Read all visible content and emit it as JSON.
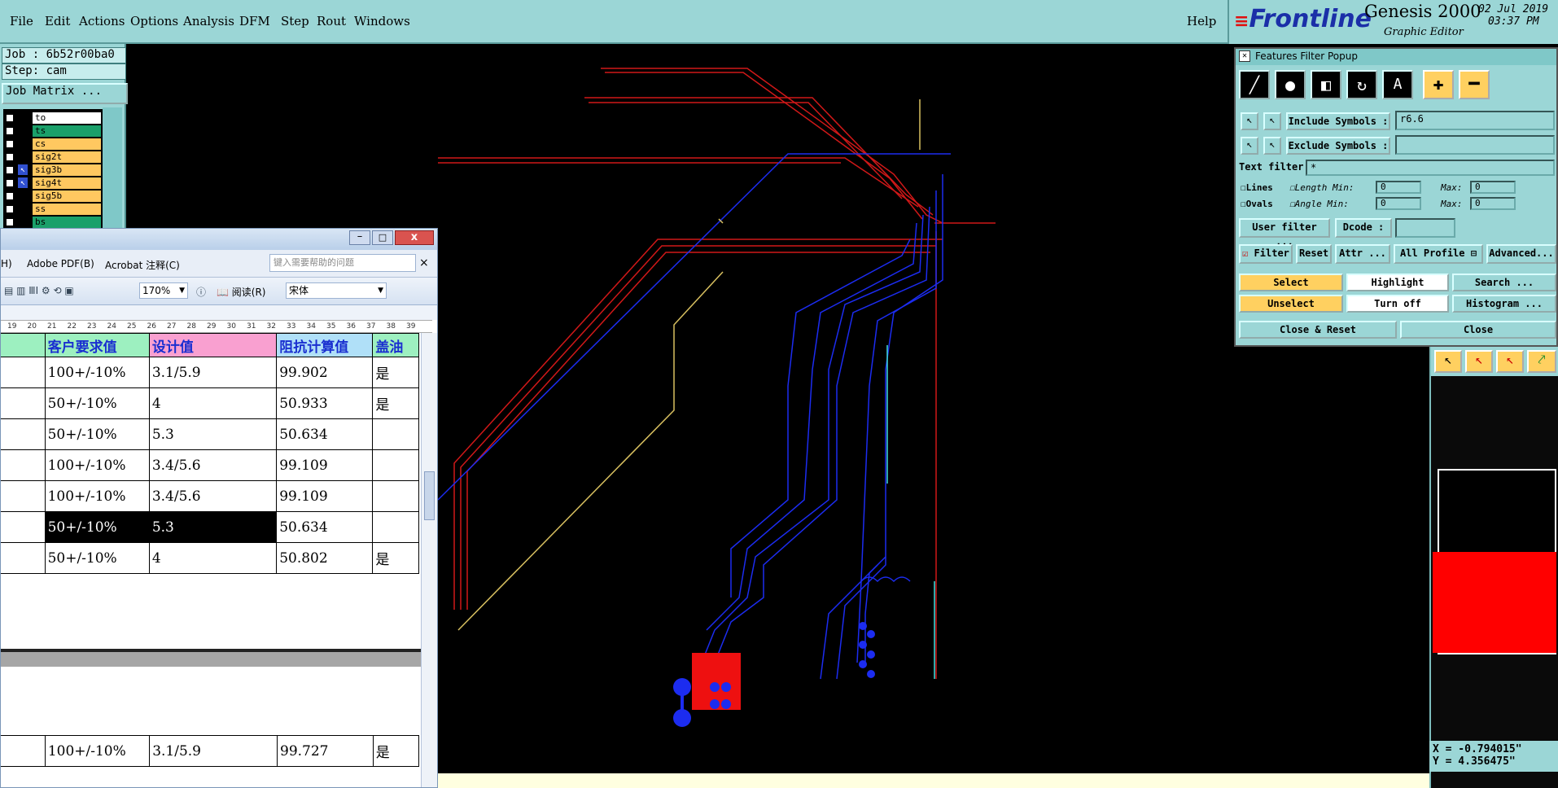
{
  "menubar": {
    "items": [
      "File",
      "Edit",
      "Actions",
      "Options",
      "Analysis",
      "DFM",
      "Step",
      "Rout",
      "Windows"
    ],
    "help": "Help"
  },
  "brand": {
    "logo": "Frontline",
    "product": "Genesis 2000",
    "subtitle": "Graphic Editor",
    "date": "02 Jul 2019",
    "time": "03:37 PM"
  },
  "left": {
    "job": "Job : 6b52r00ba0",
    "step": "Step: cam",
    "matrix_button": "Job Matrix ...",
    "layers": [
      {
        "name": "to",
        "color": "#ffffff",
        "icon": ""
      },
      {
        "name": "ts",
        "color": "#1aa06a",
        "icon": ""
      },
      {
        "name": "cs",
        "color": "#ffc860",
        "icon": ""
      },
      {
        "name": "sig2t",
        "color": "#ffc860",
        "icon": ""
      },
      {
        "name": "sig3b",
        "color": "#ffc860",
        "icon": "arrow"
      },
      {
        "name": "sig4t",
        "color": "#ffc860",
        "icon": "arrow"
      },
      {
        "name": "sig5b",
        "color": "#ffc860",
        "icon": ""
      },
      {
        "name": "ss",
        "color": "#ffc860",
        "icon": ""
      },
      {
        "name": "bs",
        "color": "#1aa06a",
        "icon": ""
      }
    ]
  },
  "word": {
    "menu": [
      "H)",
      "Adobe PDF(B)",
      "Acrobat 注释(C)"
    ],
    "help_placeholder": "键入需要帮助的问题",
    "zoom": "170%",
    "read_btn": "阅读(R)",
    "font": "宋体",
    "ruler": [
      "19",
      "20",
      "21",
      "22",
      "23",
      "24",
      "25",
      "26",
      "27",
      "28",
      "29",
      "30",
      "31",
      "32",
      "33",
      "34",
      "35",
      "36",
      "37",
      "38",
      "39"
    ],
    "headers": [
      "客户要求值",
      "设计值",
      "阻抗计算值",
      "盖油"
    ],
    "rows": [
      [
        "100+/-10%",
        "3.1/5.9",
        "99.902",
        "是"
      ],
      [
        "50+/-10%",
        "4",
        "50.933",
        "是"
      ],
      [
        "50+/-10%",
        "5.3",
        "50.634",
        ""
      ],
      [
        "100+/-10%",
        "3.4/5.6",
        "99.109",
        ""
      ],
      [
        "100+/-10%",
        "3.4/5.6",
        "99.109",
        ""
      ],
      [
        "50+/-10%",
        "5.3",
        "50.634",
        ""
      ],
      [
        "50+/-10%",
        "4",
        "50.802",
        "是"
      ]
    ],
    "row_last": [
      "100+/-10%",
      "3.1/5.9",
      "99.727",
      "是"
    ]
  },
  "popup": {
    "title": "Features Filter Popup",
    "include_label": "Include Symbols :",
    "include_value": "r6.6",
    "exclude_label": "Exclude Symbols :",
    "text_filter_label": "Text filter",
    "text_filter_value": "*",
    "lines": "Lines",
    "ovals": "Ovals",
    "length": "Length",
    "angle": "Angle",
    "min": "Min:",
    "max": "Max:",
    "zero": "0",
    "user_filter": "User filter ...",
    "dcode": "Dcode :",
    "filter": "Filter",
    "reset": "Reset",
    "attr": "Attr ...",
    "all_profile": "All Profile",
    "advanced": "Advanced...",
    "select": "Select",
    "highlight": "Highlight",
    "search": "Search ...",
    "unselect": "Unselect",
    "turn_off": "Turn off",
    "histogram": "Histogram ...",
    "close_reset": "Close & Reset",
    "close": "Close"
  },
  "coords": {
    "x": "X = -0.794015\"",
    "y": "Y = 4.356475\""
  }
}
